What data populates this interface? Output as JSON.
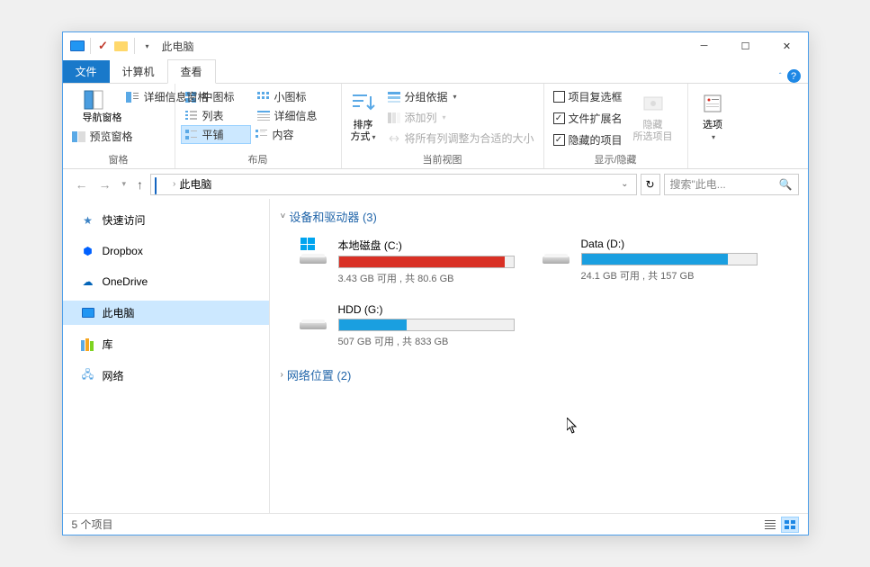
{
  "titlebar": {
    "title": "此电脑"
  },
  "tabs": {
    "file": "文件",
    "computer": "计算机",
    "view": "查看"
  },
  "ribbon": {
    "panes": {
      "label": "窗格",
      "nav_pane": "导航窗格",
      "preview_pane": "预览窗格",
      "details_pane": "详细信息窗格"
    },
    "layout": {
      "label": "布局",
      "medium": "中图标",
      "small": "小图标",
      "list": "列表",
      "details": "详细信息",
      "tiles": "平铺",
      "content": "内容"
    },
    "current_view": {
      "label": "当前视图",
      "sort": "排序方式",
      "group": "分组依据",
      "add_columns": "添加列",
      "size_all": "将所有列调整为合适的大小"
    },
    "show_hide": {
      "label": "显示/隐藏",
      "checkboxes": "项目复选框",
      "extensions": "文件扩展名",
      "hidden": "隐藏的项目",
      "hide_selected": "隐藏",
      "hide_selected2": "所选项目"
    },
    "options": {
      "label": "选项"
    }
  },
  "nav": {
    "location": "此电脑",
    "search_placeholder": "搜索\"此电..."
  },
  "sidebar": {
    "quick": "快速访问",
    "dropbox": "Dropbox",
    "onedrive": "OneDrive",
    "thispc": "此电脑",
    "libraries": "库",
    "network": "网络"
  },
  "content": {
    "section1": "设备和驱动器 (3)",
    "section2": "网络位置 (2)",
    "drives": [
      {
        "name": "本地磁盘 (C:)",
        "stat": "3.43 GB 可用 , 共 80.6 GB",
        "fill": 95,
        "color": "#d93025",
        "os": true
      },
      {
        "name": "Data (D:)",
        "stat": "24.1 GB 可用 , 共 157 GB",
        "fill": 84,
        "color": "#1a9fe0",
        "os": false
      },
      {
        "name": "HDD (G:)",
        "stat": "507 GB 可用 , 共 833 GB",
        "fill": 39,
        "color": "#1a9fe0",
        "os": false
      }
    ]
  },
  "statusbar": {
    "text": "5 个项目"
  }
}
